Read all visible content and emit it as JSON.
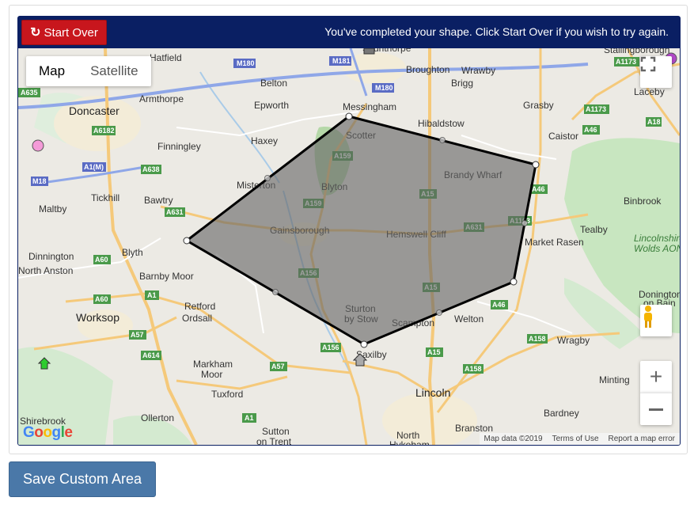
{
  "toolbar": {
    "start_over_label": "Start Over",
    "message": "You've completed your shape. Click Start Over if you wish to try again."
  },
  "map": {
    "type_tabs": [
      "Map",
      "Satellite"
    ],
    "active_tab": "Map",
    "logo": "Google",
    "attribution": [
      "Map data ©2019",
      "Terms of Use",
      "Report a map error"
    ],
    "places": [
      {
        "name": "Hatfield"
      },
      {
        "name": "Scunthorpe"
      },
      {
        "name": "Broughton"
      },
      {
        "name": "Wrawby"
      },
      {
        "name": "Stallingborough"
      },
      {
        "name": "Belton"
      },
      {
        "name": "Brigg"
      },
      {
        "name": "Laceby"
      },
      {
        "name": "Doncaster"
      },
      {
        "name": "Armthorpe"
      },
      {
        "name": "Epworth"
      },
      {
        "name": "Messingham"
      },
      {
        "name": "Grasby"
      },
      {
        "name": "Hibaldstow"
      },
      {
        "name": "Caistor"
      },
      {
        "name": "Finningley"
      },
      {
        "name": "Haxey"
      },
      {
        "name": "Scotter"
      },
      {
        "name": "Brandy Wharf"
      },
      {
        "name": "Misterton"
      },
      {
        "name": "Blyton"
      },
      {
        "name": "Tickhill"
      },
      {
        "name": "Bawtry"
      },
      {
        "name": "Maltby"
      },
      {
        "name": "Binbrook"
      },
      {
        "name": "Gainsborough"
      },
      {
        "name": "Hemswell Cliff"
      },
      {
        "name": "Tealby"
      },
      {
        "name": "Market Rasen"
      },
      {
        "name": "Dinnington"
      },
      {
        "name": "Blyth"
      },
      {
        "name": "North Anston"
      },
      {
        "name": "Barnby Moor"
      },
      {
        "name": "Retford"
      },
      {
        "name": "Ordsall"
      },
      {
        "name": "Worksop"
      },
      {
        "name": "Sturton by Stow"
      },
      {
        "name": "Scampton"
      },
      {
        "name": "Welton"
      },
      {
        "name": "Wragby"
      },
      {
        "name": "Saxilby"
      },
      {
        "name": "Markham Moor"
      },
      {
        "name": "Minting"
      },
      {
        "name": "Tuxford"
      },
      {
        "name": "Lincoln"
      },
      {
        "name": "Shirebrook"
      },
      {
        "name": "Ollerton"
      },
      {
        "name": "Bardney"
      },
      {
        "name": "Branston"
      },
      {
        "name": "Sutton on Trent"
      },
      {
        "name": "North Hykeham"
      },
      {
        "name": "Lincolnshire Wolds AONB"
      },
      {
        "name": "Donington on Bain"
      }
    ],
    "roads": [
      "M180",
      "M181",
      "A635",
      "A6182",
      "A1(M)",
      "M18",
      "A638",
      "A631",
      "A60",
      "A1",
      "A57",
      "A614",
      "A159",
      "A15",
      "A156",
      "A1173",
      "A18",
      "A46",
      "A1103",
      "A158"
    ],
    "polygon_vertices": [
      {
        "lat": 53.5465,
        "lng": -0.6565
      },
      {
        "lat": 53.4826,
        "lng": -0.3237
      },
      {
        "lat": 53.3536,
        "lng": -0.3607
      },
      {
        "lat": 53.2702,
        "lng": -0.6108
      },
      {
        "lat": 53.4016,
        "lng": -0.8775
      }
    ],
    "fill_color": "#666666",
    "stroke_color": "#000000"
  },
  "save_button_label": "Save Custom Area"
}
